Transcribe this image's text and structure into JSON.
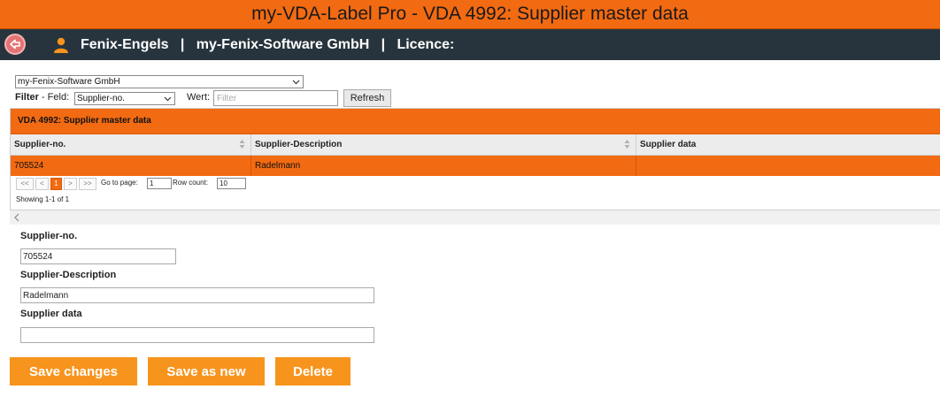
{
  "window": {
    "title": "my-VDA-Label Pro - VDA 4992: Supplier master data"
  },
  "userbar": {
    "text": "Fenix-Engels   |   my-Fenix-Software GmbH   |   Licence:"
  },
  "company_select": {
    "value": "my-Fenix-Software GmbH"
  },
  "filter": {
    "label_bold": "Filter",
    "label_rest": " - Feld:",
    "field_value": "Supplier-no.",
    "wert_label": "Wert:",
    "placeholder": "Filter",
    "refresh_label": "Refresh"
  },
  "grid": {
    "caption": "VDA 4992: Supplier master data",
    "columns": [
      "Supplier-no.",
      "Supplier-Description",
      "Supplier data"
    ],
    "rows": [
      {
        "supplier_no": "705524",
        "description": "Radelmann",
        "data": ""
      }
    ],
    "pager": {
      "first": "<<",
      "prev": "<",
      "page": "1",
      "next": ">",
      "last": ">>",
      "goto_label": "Go to page:",
      "goto_value": "1",
      "rowcount_label": "Row count:",
      "rowcount_value": "10",
      "showing": "Showing 1-1 of 1"
    }
  },
  "form": {
    "supplier_no_label": "Supplier-no.",
    "supplier_no_value": "705524",
    "description_label": "Supplier-Description",
    "description_value": "Radelmann",
    "data_label": "Supplier data",
    "data_value": ""
  },
  "actions": {
    "save_changes": "Save changes",
    "save_as_new": "Save as new",
    "delete": "Delete"
  },
  "colors": {
    "accent": "#f26a12",
    "button": "#f7941d",
    "bar": "#27343d"
  }
}
